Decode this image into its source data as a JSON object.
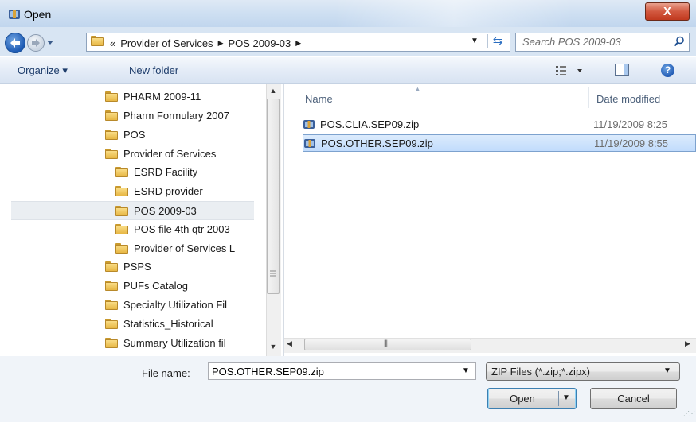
{
  "window": {
    "title": "Open",
    "close_glyph": "X"
  },
  "address": {
    "overflow": "«",
    "crumbs": [
      "Provider of Services",
      "POS 2009-03"
    ],
    "separator": "▶"
  },
  "search": {
    "placeholder": "Search POS 2009-03"
  },
  "toolbar": {
    "organize": "Organize ▾",
    "new_folder": "New folder",
    "help": "?"
  },
  "nav": {
    "items": [
      {
        "label": "PHARM 2009-11",
        "indent": 1
      },
      {
        "label": "Pharm Formulary 2007",
        "indent": 1
      },
      {
        "label": "POS",
        "indent": 1
      },
      {
        "label": "Provider of Services",
        "indent": 1
      },
      {
        "label": "ESRD Facility",
        "indent": 2
      },
      {
        "label": "ESRD provider",
        "indent": 2
      },
      {
        "label": "POS 2009-03",
        "indent": 2,
        "selected": true
      },
      {
        "label": "POS file 4th qtr 2003",
        "indent": 2
      },
      {
        "label": "Provider of Services L",
        "indent": 2
      },
      {
        "label": "PSPS",
        "indent": 1
      },
      {
        "label": "PUFs Catalog",
        "indent": 1
      },
      {
        "label": "Specialty Utilization Fil",
        "indent": 1
      },
      {
        "label": "Statistics_Historical",
        "indent": 1
      },
      {
        "label": "Summary Utilization fil",
        "indent": 1
      }
    ]
  },
  "files": {
    "columns": {
      "name": "Name",
      "date": "Date modified"
    },
    "rows": [
      {
        "name": "POS.CLIA.SEP09.zip",
        "date": "11/19/2009 8:25"
      },
      {
        "name": "POS.OTHER.SEP09.zip",
        "date": "11/19/2009 8:55",
        "selected": true
      }
    ]
  },
  "bottom": {
    "file_name_label": "File name:",
    "file_name_value": "POS.OTHER.SEP09.zip",
    "file_type": "ZIP Files (*.zip;*.zipx)",
    "open_label": "Open",
    "cancel_label": "Cancel"
  }
}
